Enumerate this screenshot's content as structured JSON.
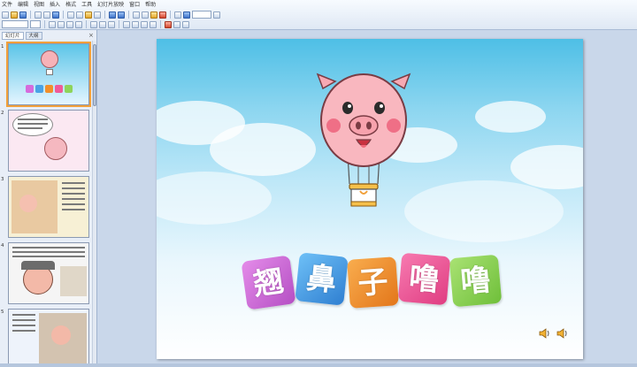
{
  "menu": {
    "items": [
      "文件",
      "编辑",
      "视图",
      "插入",
      "格式",
      "工具",
      "幻灯片放映",
      "窗口",
      "帮助"
    ]
  },
  "panel": {
    "tabs": [
      "幻灯片",
      "大纲"
    ],
    "close_glyph": "×",
    "slides": [
      {
        "number": "1"
      },
      {
        "number": "2"
      },
      {
        "number": "3"
      },
      {
        "number": "4"
      },
      {
        "number": "5"
      }
    ]
  },
  "slide": {
    "characters": [
      "翘",
      "鼻",
      "子",
      "噜",
      "噜"
    ],
    "card_colors": [
      "#d66bdc",
      "#4aa3e6",
      "#f28f2a",
      "#f05a9a",
      "#8ed45a"
    ]
  },
  "icons": {
    "speaker_left": "speaker-icon",
    "speaker_right": "speaker-icon",
    "pig": "pig-balloon-icon"
  },
  "colors": {
    "selection": "#f2a03a",
    "sky_top": "#4ebfe6"
  }
}
